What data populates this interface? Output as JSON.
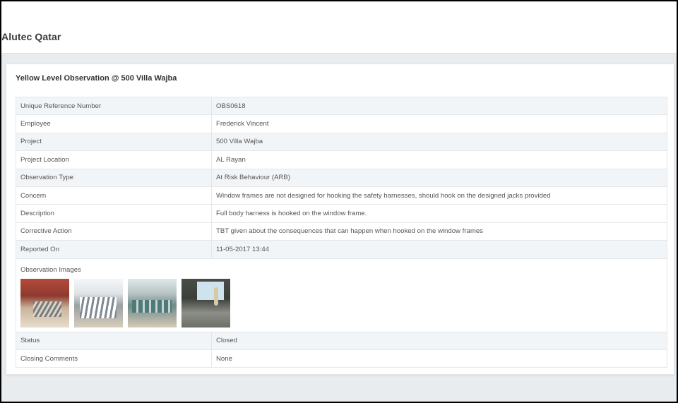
{
  "app": {
    "brand": "Alutec Qatar"
  },
  "card": {
    "title": "Yellow Level Observation @ 500 Villa Wajba",
    "rows_top": [
      {
        "label": "Unique Reference Number",
        "value": "OBS0618"
      },
      {
        "label": "Employee",
        "value": "Frederick Vincent"
      },
      {
        "label": "Project",
        "value": "500 Villa Wajba"
      },
      {
        "label": "Project Location",
        "value": "AL Rayan"
      },
      {
        "label": "Observation Type",
        "value": "At Risk Behaviour (ARB)"
      },
      {
        "label": "Concern",
        "value": "Window frames are not designed for hooking the safety harnesses, should hook on the designed jacks provided"
      },
      {
        "label": "Description",
        "value": "Full body harness is hooked on the window frame."
      },
      {
        "label": "Corrective Action",
        "value": "TBT given about the consequences that can happen when hooked on the window frames"
      },
      {
        "label": "Reported On",
        "value": "11-05-2017 13:44"
      }
    ],
    "images_label": "Observation Images",
    "images": [
      "observation-image-1",
      "observation-image-2",
      "observation-image-3",
      "observation-image-4"
    ],
    "rows_bottom": [
      {
        "label": "Status",
        "value": "Closed"
      },
      {
        "label": "Closing Comments",
        "value": "None"
      }
    ]
  }
}
